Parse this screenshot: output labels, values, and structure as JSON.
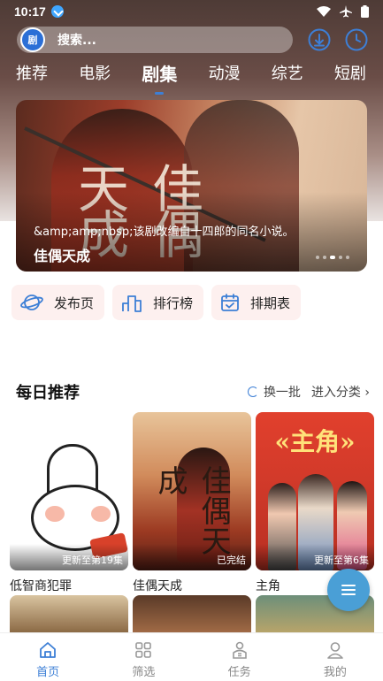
{
  "status_bar": {
    "time": "10:17"
  },
  "search": {
    "placeholder": "搜索..."
  },
  "app_logo_text": "剧",
  "tabs": [
    "推荐",
    "电影",
    "剧集",
    "动漫",
    "综艺",
    "短剧"
  ],
  "active_tab": "剧集",
  "banner": {
    "description": "&amp;amp;nbsp;该剧改编自十四郎的同名小说。",
    "title": "佳偶天成",
    "calligraphy": "佳偶天成",
    "slides_count": 5,
    "active_slide": 3
  },
  "quick_actions": [
    {
      "label": "发布页",
      "icon": "planet-icon"
    },
    {
      "label": "排行榜",
      "icon": "ranking-icon"
    },
    {
      "label": "排期表",
      "icon": "calendar-icon"
    }
  ],
  "section": {
    "title": "每日推荐",
    "refresh_label": "换一批",
    "more_label": "进入分类 ›"
  },
  "cards": [
    {
      "title": "低智商犯罪",
      "tag": "更新至第19集"
    },
    {
      "title": "佳偶天成",
      "tag": "已完结"
    },
    {
      "title": "主角",
      "tag": "更新至第6集",
      "poster_title": "«主角»"
    }
  ],
  "bottom_nav": [
    {
      "label": "首页",
      "icon": "home-icon",
      "active": true
    },
    {
      "label": "筛选",
      "icon": "filter-grid-icon",
      "active": false
    },
    {
      "label": "任务",
      "icon": "task-icon",
      "active": false
    },
    {
      "label": "我的",
      "icon": "profile-icon",
      "active": false
    }
  ],
  "colors": {
    "accent": "#3d7fd6",
    "fab": "#4a9fd6",
    "quick_bg": "#fdf0ef"
  }
}
